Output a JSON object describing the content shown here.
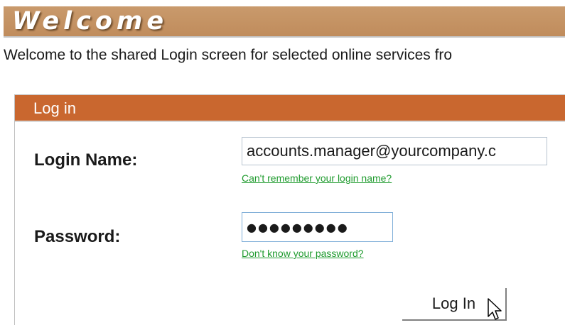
{
  "welcome": {
    "title": "Welcome",
    "intro_text": "Welcome to the shared Login screen for selected online services fro"
  },
  "login_panel": {
    "header": "Log in",
    "login_name": {
      "label": "Login Name:",
      "value": "accounts.manager@yourcompany.c",
      "help_link": "Can't remember your login name?"
    },
    "password": {
      "label": "Password:",
      "masked_value": "●●●●●●●●●",
      "help_link": "Don't know your password?"
    },
    "submit_label": "Log In"
  },
  "colors": {
    "welcome_bar": "#c4915f",
    "panel_header": "#c9672f",
    "link": "#1f9b2e"
  },
  "icons": {
    "cursor": "arrow-cursor-icon"
  }
}
